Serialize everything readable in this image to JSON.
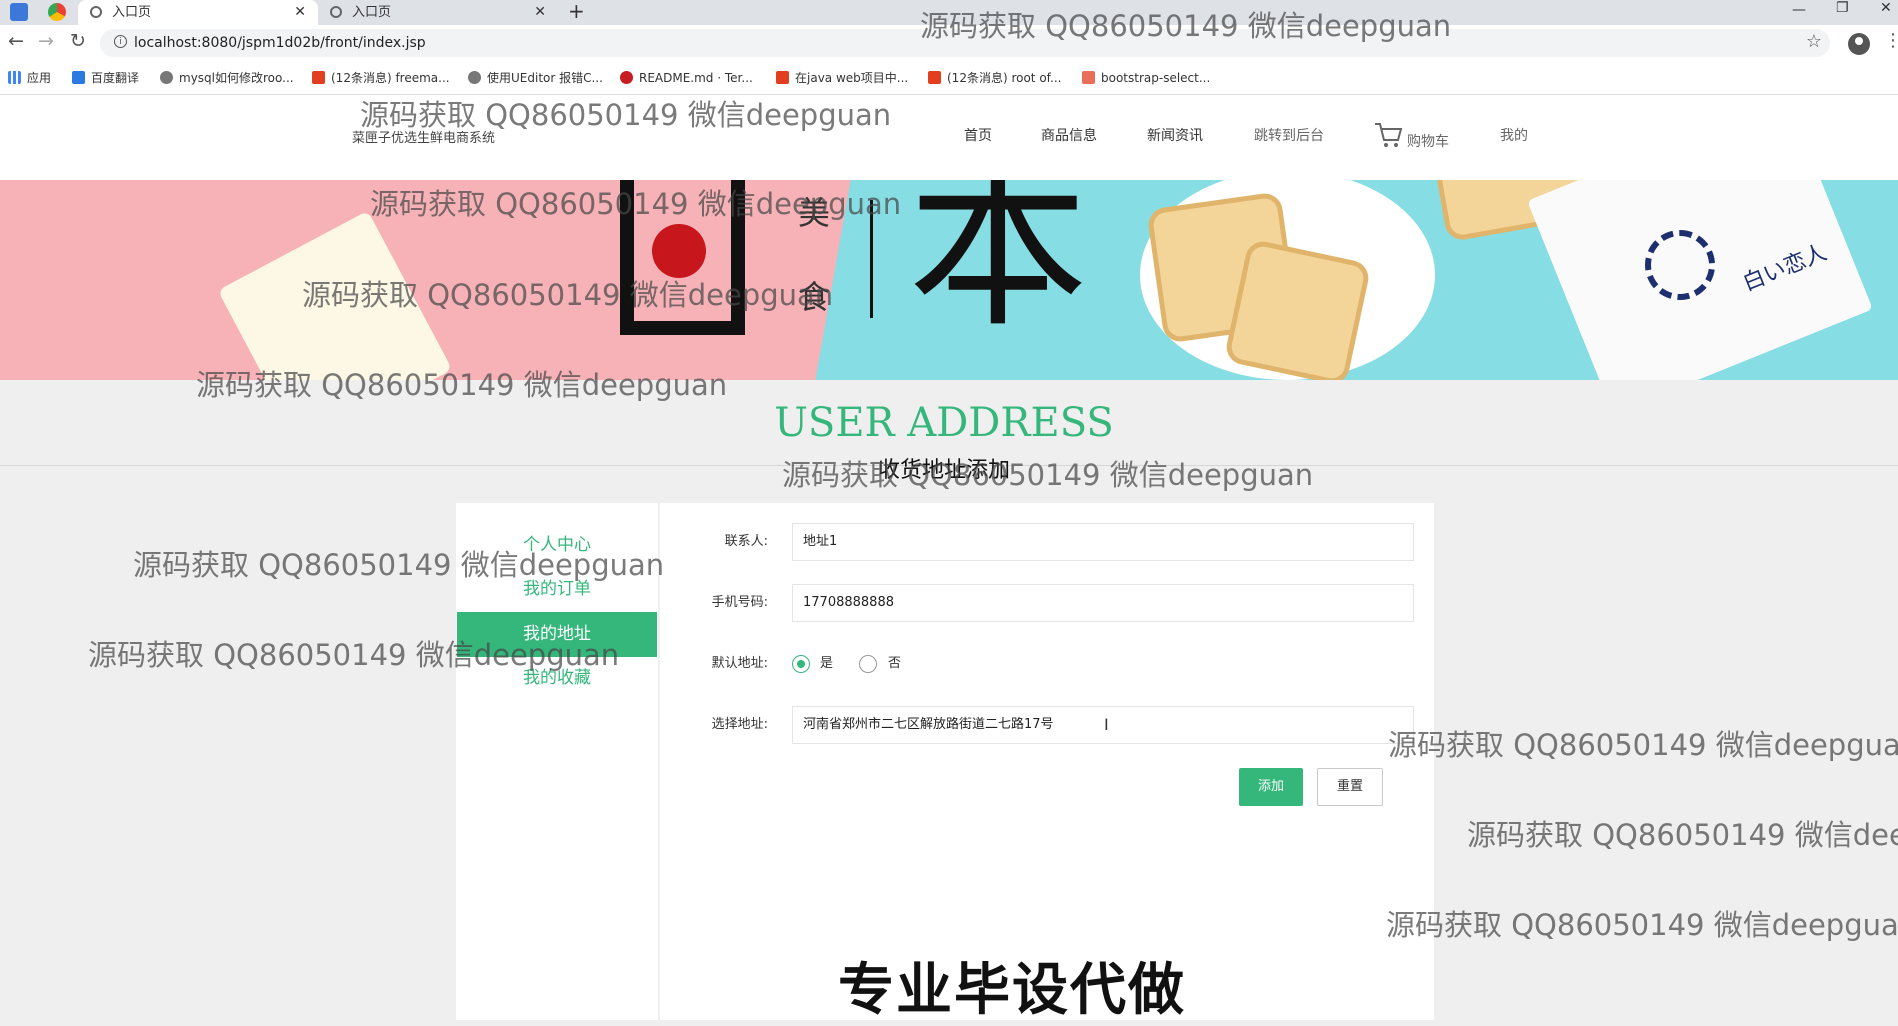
{
  "browser": {
    "tabs": [
      {
        "title": "入口页",
        "active": true
      },
      {
        "title": "入口页",
        "active": false
      }
    ],
    "new_tab": "+",
    "url": "localhost:8080/jspm1d02b/front/index.jsp",
    "bookmarks": [
      "应用",
      "百度翻译",
      "mysql如何修改roo...",
      "(12条消息) freema...",
      "使用UEditor 报错C...",
      "README.md · Ter...",
      "在java web项目中...",
      "(12条消息) root of...",
      "bootstrap-select..."
    ]
  },
  "site": {
    "logo_text": "菜匣子优选生鲜电商系统",
    "nav": [
      "首页",
      "商品信息",
      "新闻资讯",
      "跳转到后台",
      "购物车",
      "我的"
    ]
  },
  "banner": {
    "chars": [
      "日",
      "本",
      "美",
      "食"
    ]
  },
  "section": {
    "title": "USER ADDRESS",
    "subtitle": "收货地址添加"
  },
  "sidebar": {
    "items": [
      {
        "label": "个人中心",
        "active": false
      },
      {
        "label": "我的订单",
        "active": false
      },
      {
        "label": "我的地址",
        "active": true
      },
      {
        "label": "我的收藏",
        "active": false
      }
    ]
  },
  "form": {
    "contact_label": "联系人:",
    "contact_value": "地址1",
    "phone_label": "手机号码:",
    "phone_value": "17708888888",
    "default_label": "默认地址:",
    "default_yes": "是",
    "default_no": "否",
    "default_selected": "是",
    "address_label": "选择地址:",
    "address_value": "河南省郑州市二七区解放路街道二七路17号",
    "add_button": "添加",
    "reset_button": "重置"
  },
  "overlay": {
    "watermark": "源码获取 QQ86050149 微信deepguan",
    "caption": "专业毕设代做"
  },
  "colors": {
    "accent": "#35b77c",
    "banner_pink": "#f6b2b6",
    "banner_cyan": "#86dde3"
  }
}
